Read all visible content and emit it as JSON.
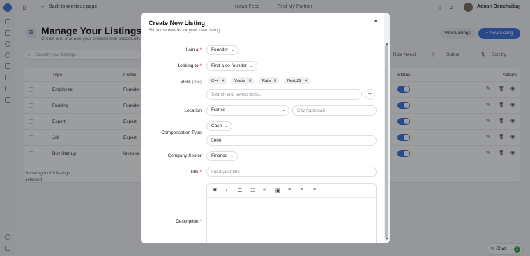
{
  "topbar": {
    "back_label": "Back to previous page",
    "nav": [
      "News Feed",
      "Find My Partner"
    ],
    "user_name": "Adnan Benchaiba"
  },
  "page": {
    "title": "Manage Your Listings",
    "subtitle": "Create and manage your professional opportunity",
    "view_button": "View Listings",
    "new_button": "New Listing",
    "search_placeholder": "Search your listings...",
    "filters": {
      "role": "Role Needi",
      "status": "Status",
      "sort": "Sort by"
    },
    "columns": [
      "Type",
      "Profile",
      "Status",
      "Actions"
    ],
    "rows": [
      {
        "type": "Employee",
        "profile": "Founder",
        "status_on": true
      },
      {
        "type": "Funding",
        "profile": "Founder",
        "status_on": true
      },
      {
        "type": "Expert",
        "profile": "Expert",
        "status_on": true
      },
      {
        "type": "Job",
        "profile": "Expert",
        "status_on": true
      },
      {
        "type": "Buy Startup",
        "profile": "Investor",
        "status_on": true
      }
    ],
    "footer": "Showing 0 of 5 listings selected.",
    "chat_label": "Chat",
    "chat_count": "2"
  },
  "modal": {
    "title": "Create New Listing",
    "subtitle": "Fill in the details for your new listing.",
    "fields": {
      "i_am": {
        "label": "I am a",
        "value": "Founder"
      },
      "looking_to": {
        "label": "Looking to",
        "value": "Find a co-founder"
      },
      "skills": {
        "label": "Skills",
        "count": "(4/5)",
        "chips": [
          "C++",
          "Vue.js",
          "Rails",
          "Nest.JS"
        ],
        "placeholder": "Search and select skills..."
      },
      "location": {
        "label": "Location",
        "value": "France",
        "city_placeholder": "City (optional)"
      },
      "compensation_type": {
        "label": "Compensation Type",
        "value": "Cash",
        "amount": "5000"
      },
      "company_sector": {
        "label": "Company Sector",
        "value": "Finance"
      },
      "title": {
        "label": "Title",
        "placeholder": "Input your title"
      },
      "description": {
        "label": "Description"
      }
    }
  }
}
